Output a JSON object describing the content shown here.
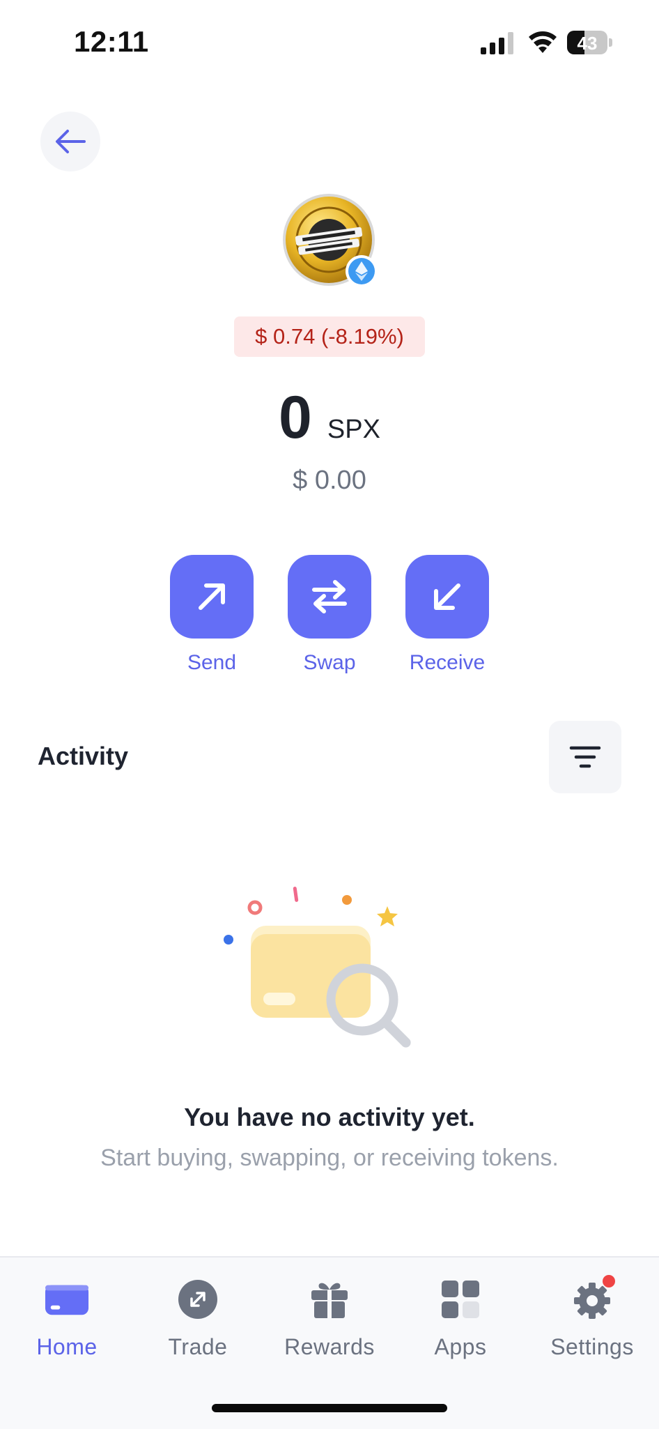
{
  "status_bar": {
    "time": "12:11",
    "battery_level": "43",
    "battery_fraction": 0.43
  },
  "header": {
    "back_icon": "arrow-left-icon"
  },
  "token": {
    "logo_icon": "spx6900-coin-logo",
    "chain_icon": "ethereum-badge-icon",
    "price_change": "$ 0.74 (-8.19%)",
    "balance": "0",
    "symbol": "SPX",
    "usd_value": "$ 0.00"
  },
  "actions": [
    {
      "label": "Send",
      "icon": "arrow-up-right-icon"
    },
    {
      "label": "Swap",
      "icon": "swap-arrows-icon"
    },
    {
      "label": "Receive",
      "icon": "arrow-down-left-icon"
    }
  ],
  "activity": {
    "title": "Activity",
    "filter_icon": "filter-icon",
    "empty_title": "You have no activity yet.",
    "empty_subtitle": "Start buying, swapping, or receiving tokens."
  },
  "bottom_nav": {
    "items": [
      {
        "label": "Home",
        "icon": "wallet-icon",
        "active": true
      },
      {
        "label": "Trade",
        "icon": "trade-icon",
        "active": false
      },
      {
        "label": "Rewards",
        "icon": "gift-icon",
        "active": false
      },
      {
        "label": "Apps",
        "icon": "apps-grid-icon",
        "active": false
      },
      {
        "label": "Settings",
        "icon": "gear-icon",
        "active": false,
        "has_notification": true
      }
    ]
  },
  "colors": {
    "accent": "#646ef6",
    "accent_text": "#5b63e8",
    "negative_text": "#b42318",
    "negative_bg": "#fde8e8",
    "notification_dot": "#ef4444"
  }
}
